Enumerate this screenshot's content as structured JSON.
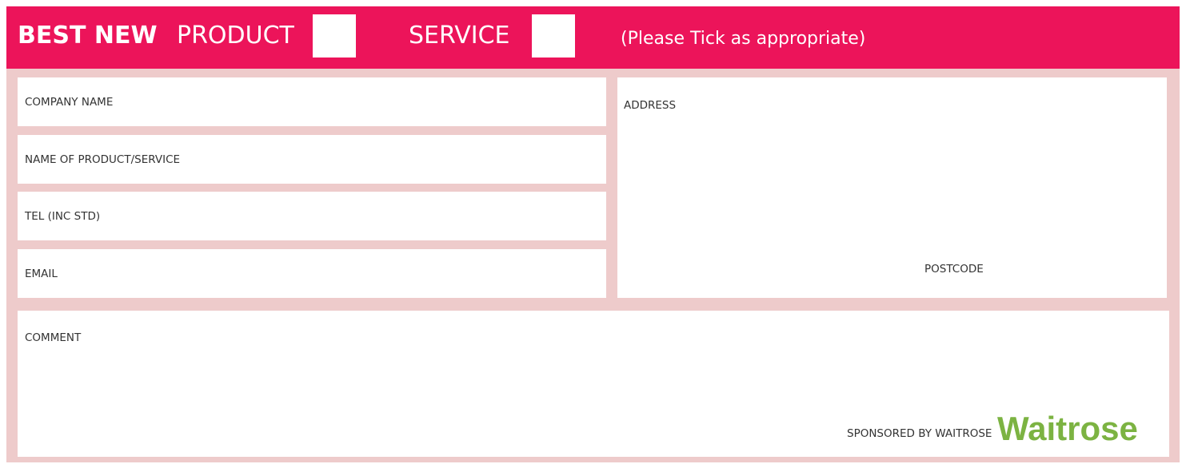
{
  "header": {
    "best_new": "BEST NEW",
    "product_label": "PRODUCT",
    "service_label": "SERVICE",
    "note": "(Please Tick as appropriate)"
  },
  "fields": {
    "company_name": "COMPANY NAME",
    "product_service_name": "NAME OF PRODUCT/SERVICE",
    "tel": "TEL (INC STD)",
    "email": "EMAIL",
    "address": "ADDRESS",
    "postcode": "POSTCODE",
    "comment": "COMMENT"
  },
  "sponsor": {
    "text": "SPONSORED BY WAITROSE",
    "logo_text": "Waitrose",
    "logo_color": "#7cb342"
  },
  "colors": {
    "header_bg": "#ec145a",
    "form_bg": "#eecbcb",
    "field_bg": "#ffffff"
  }
}
